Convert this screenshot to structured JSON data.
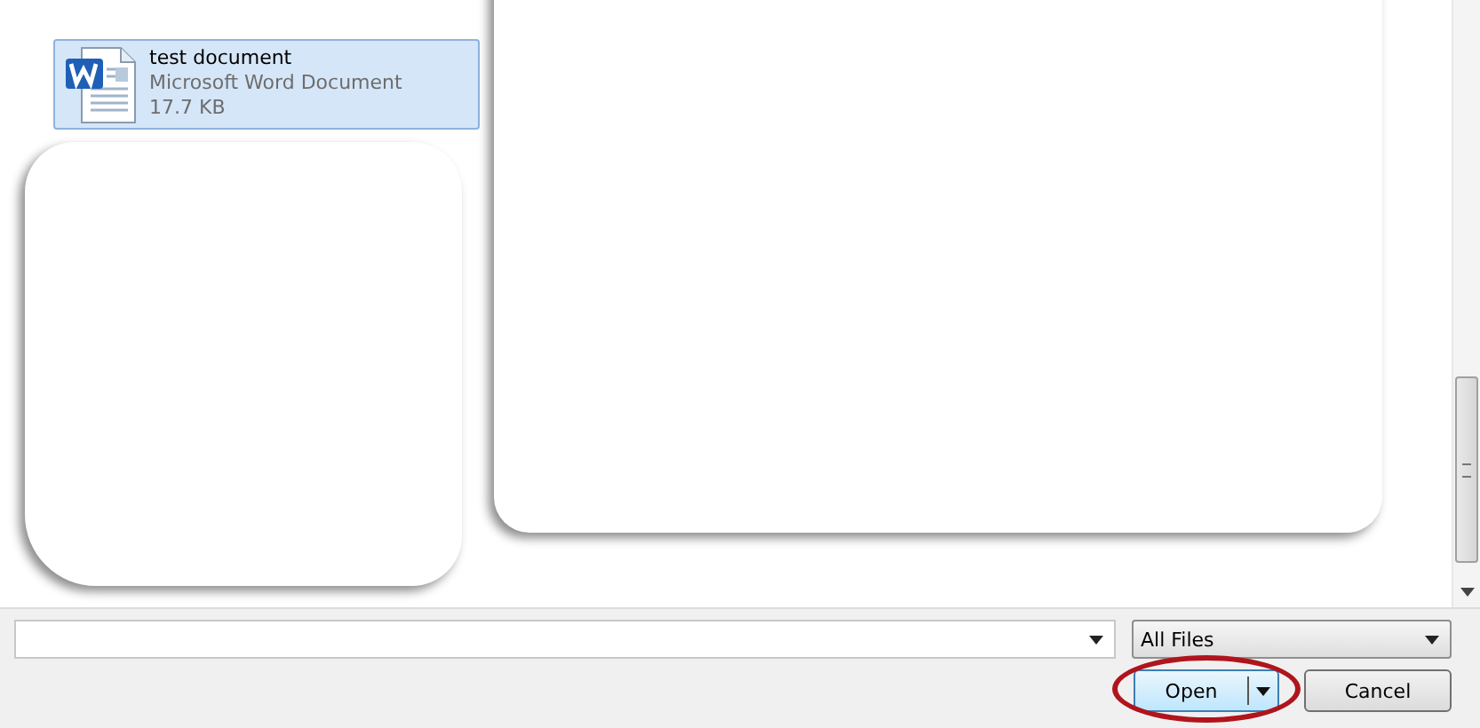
{
  "files": [
    {
      "name": "test document",
      "type": "Microsoft Word Document",
      "size": "17.7 KB",
      "selected": true
    }
  ],
  "filter": {
    "value": "All Files"
  },
  "buttons": [
    {
      "label": "Open",
      "kind": "split",
      "highlighted": true
    },
    {
      "label": "Cancel",
      "kind": "plain",
      "highlighted": false
    }
  ]
}
